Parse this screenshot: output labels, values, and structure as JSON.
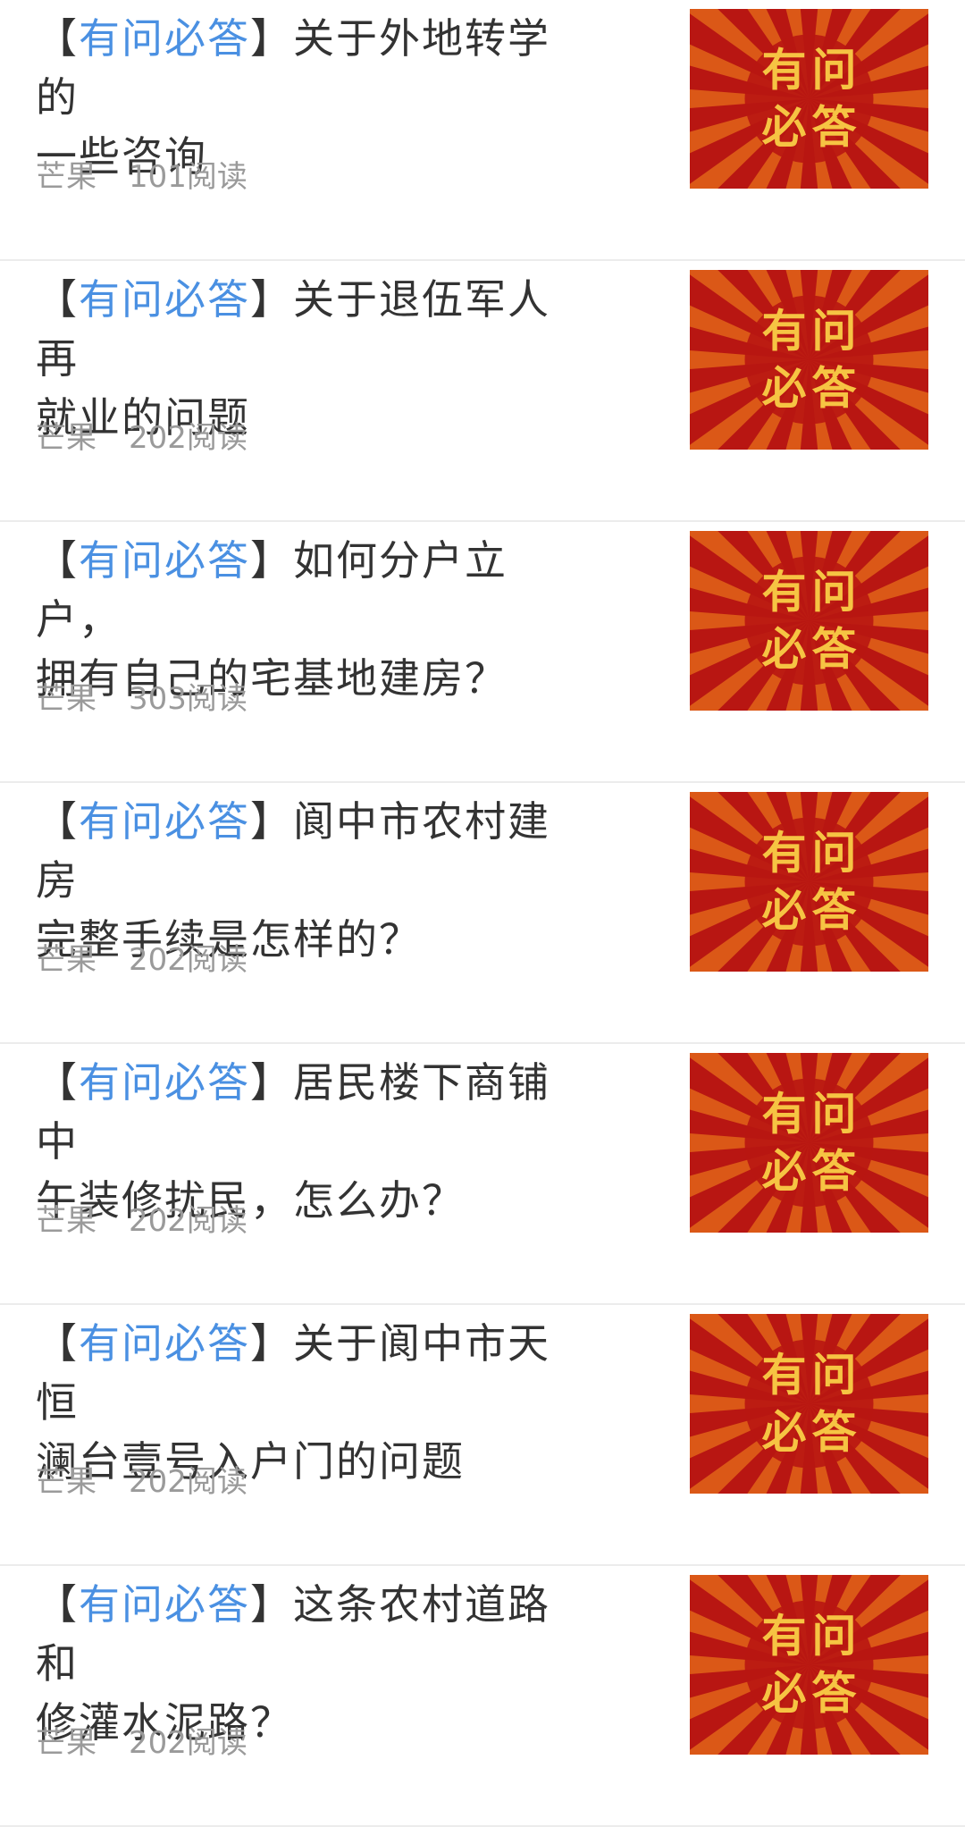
{
  "tag_open": "【",
  "tag_text": "有问必答",
  "tag_close": "】",
  "thumbnail": {
    "chars": [
      "有",
      "问",
      "必",
      "答"
    ],
    "colors": {
      "bg": "#b81612",
      "ray": "#e06419",
      "text": "#f6c443"
    }
  },
  "colors": {
    "tag": "#4a90e2",
    "title": "#333333",
    "meta": "#9a9a9a",
    "divider": "#ececec"
  },
  "articles": [
    {
      "title_line1": "关于外地转学的",
      "title_line2": "一些咨询",
      "author": "芒果",
      "reads": "101阅读"
    },
    {
      "title_line1": "关于退伍军人再",
      "title_line2": "就业的问题",
      "author": "芒果",
      "reads": "202阅读"
    },
    {
      "title_line1": "如何分户立户，",
      "title_line2": "拥有自己的宅基地建房？",
      "author": "芒果",
      "reads": "303阅读"
    },
    {
      "title_line1": "阆中市农村建房",
      "title_line2": "完整手续是怎样的？",
      "author": "芒果",
      "reads": "202阅读"
    },
    {
      "title_line1": "居民楼下商铺中",
      "title_line2": "午装修扰民，怎么办？",
      "author": "芒果",
      "reads": "202阅读"
    },
    {
      "title_line1": "关于阆中市天恒",
      "title_line2": "澜台壹号入户门的问题",
      "author": "芒果",
      "reads": "202阅读"
    },
    {
      "title_line1": "这条农村道路和",
      "title_line2": "修灌水泥路？",
      "author": "芒果",
      "reads": "202阅读"
    }
  ]
}
